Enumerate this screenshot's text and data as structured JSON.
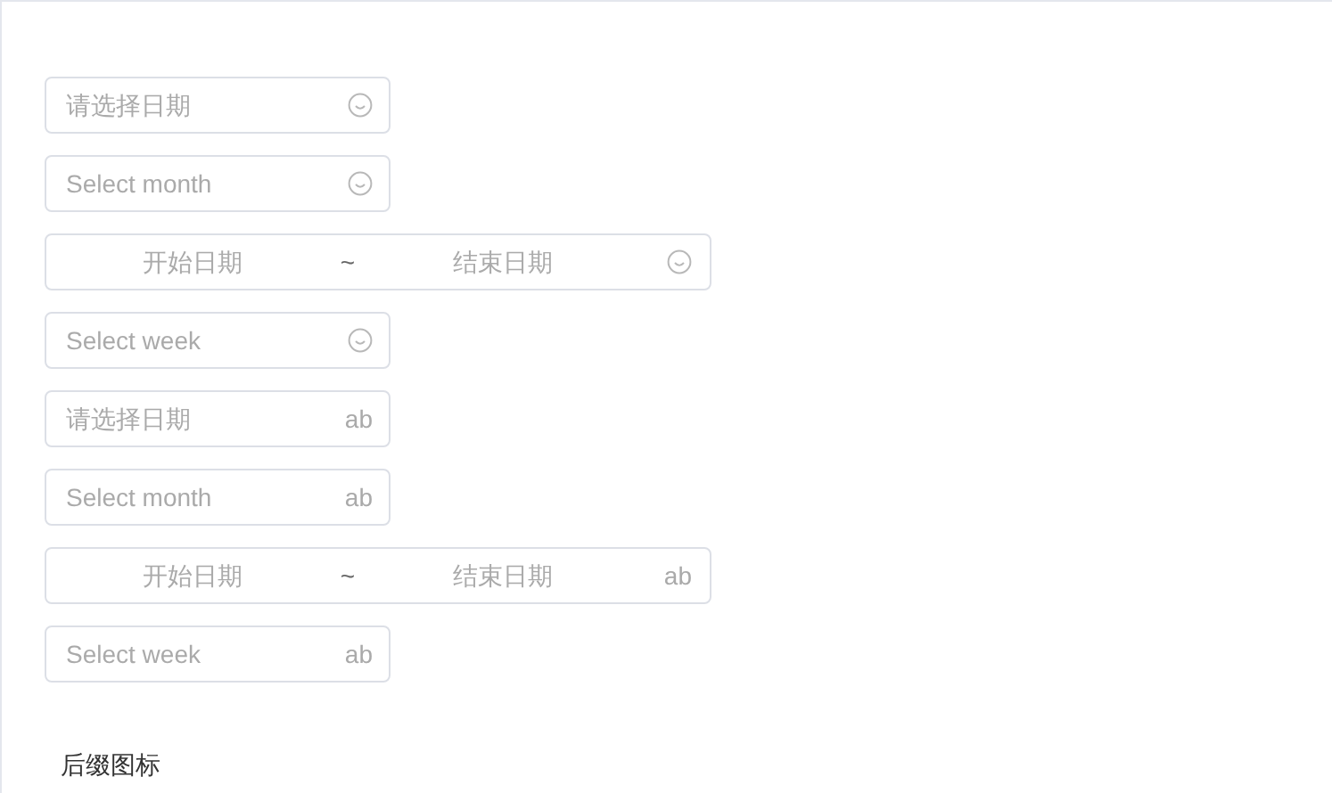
{
  "pickers": [
    {
      "kind": "single",
      "placeholder": "请选择日期",
      "suffix": {
        "kind": "icon"
      }
    },
    {
      "kind": "single",
      "placeholder": "Select month",
      "suffix": {
        "kind": "icon"
      }
    },
    {
      "kind": "range",
      "start_placeholder": "开始日期",
      "separator": "~",
      "end_placeholder": "结束日期",
      "suffix": {
        "kind": "icon"
      }
    },
    {
      "kind": "single",
      "placeholder": "Select week",
      "suffix": {
        "kind": "icon"
      }
    },
    {
      "kind": "single",
      "placeholder": "请选择日期",
      "suffix": {
        "kind": "text",
        "text": "ab"
      }
    },
    {
      "kind": "single",
      "placeholder": "Select month",
      "suffix": {
        "kind": "text",
        "text": "ab"
      }
    },
    {
      "kind": "range",
      "start_placeholder": "开始日期",
      "separator": "~",
      "end_placeholder": "结束日期",
      "suffix": {
        "kind": "text",
        "text": "ab"
      }
    },
    {
      "kind": "single",
      "placeholder": "Select week",
      "suffix": {
        "kind": "text",
        "text": "ab"
      }
    }
  ],
  "section_title": "后缀图标"
}
